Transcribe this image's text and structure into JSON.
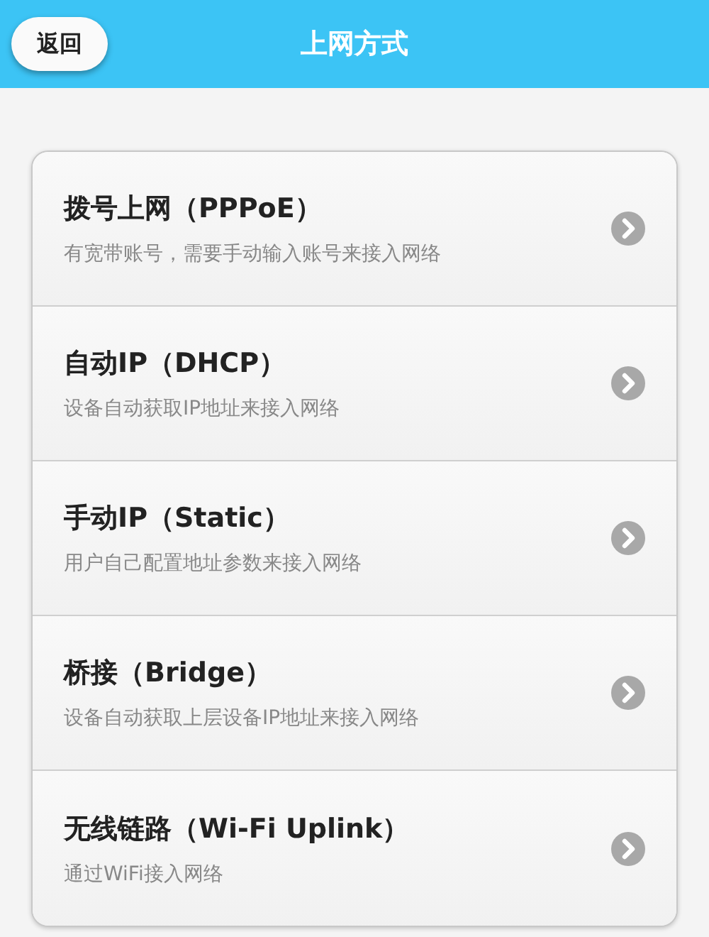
{
  "header": {
    "back_button": "返回",
    "title": "上网方式"
  },
  "options": [
    {
      "title": "拨号上网（PPPoE）",
      "description": "有宽带账号，需要手动输入账号来接入网络"
    },
    {
      "title": "自动IP（DHCP）",
      "description": "设备自动获取IP地址来接入网络"
    },
    {
      "title": "手动IP（Static）",
      "description": "用户自己配置地址参数来接入网络"
    },
    {
      "title": "桥接（Bridge）",
      "description": "设备自动获取上层设备IP地址来接入网络"
    },
    {
      "title": "无线链路（Wi-Fi Uplink）",
      "description": "通过WiFi接入网络"
    }
  ]
}
